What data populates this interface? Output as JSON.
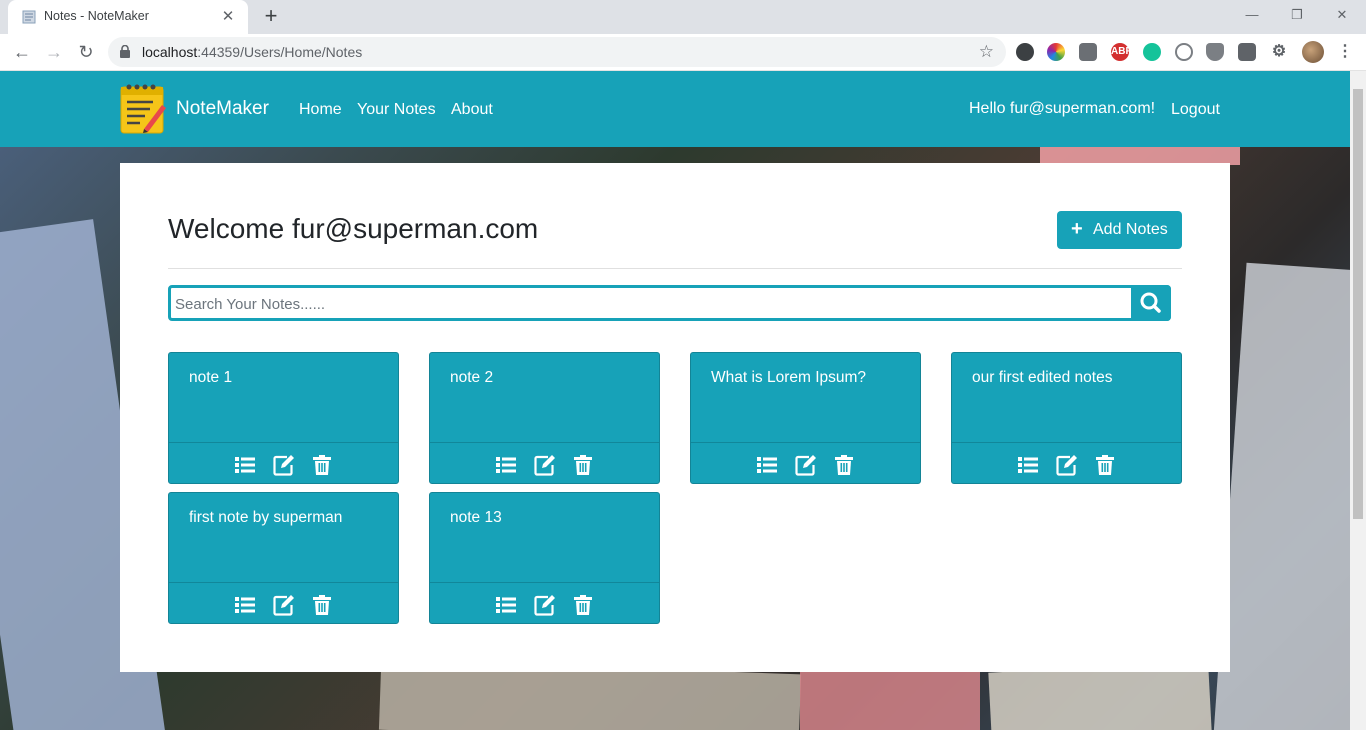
{
  "browser": {
    "tab_title": "Notes - NoteMaker",
    "tab_close": "✕",
    "new_tab": "+",
    "url_host": "localhost",
    "url_rest": ":44359/Users/Home/Notes",
    "window_minimize": "—",
    "window_restore": "❐",
    "window_close": "✕",
    "extensions": [
      "ABP"
    ]
  },
  "navbar": {
    "brand": "NoteMaker",
    "links": [
      "Home",
      "Your Notes",
      "About"
    ],
    "greeting": "Hello fur@superman.com!",
    "logout": "Logout"
  },
  "main": {
    "welcome": "Welcome fur@superman.com",
    "add_button": "Add Notes",
    "search_placeholder": "Search Your Notes......",
    "notes": [
      {
        "title": "note 1"
      },
      {
        "title": "note 2"
      },
      {
        "title": "What is Lorem Ipsum?"
      },
      {
        "title": "our first edited notes"
      },
      {
        "title": "first note by superman"
      },
      {
        "title": "note 13"
      }
    ]
  },
  "colors": {
    "accent": "#17a2b8",
    "card_bg": "#ffffff"
  }
}
